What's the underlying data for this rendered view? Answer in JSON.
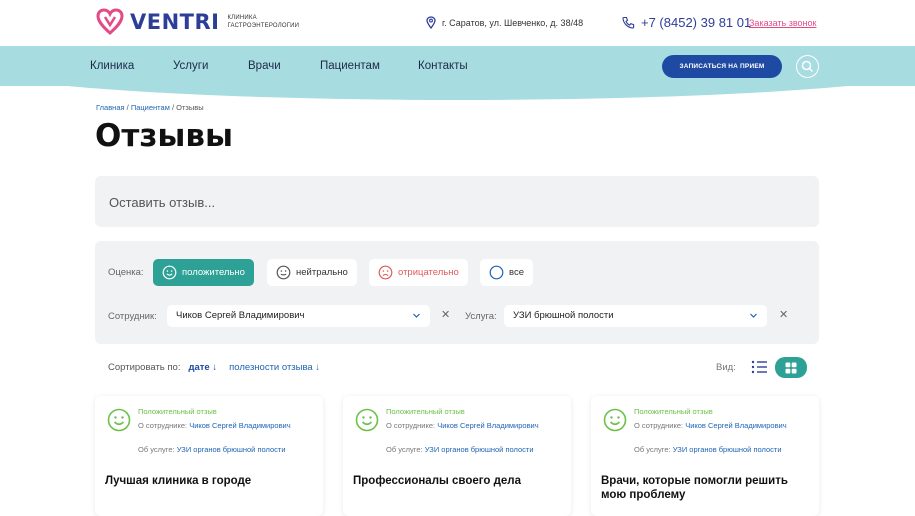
{
  "header": {
    "logo_text": "VENTRI",
    "logo_subtitle": "Клиника гастроэнтерологии",
    "address": "г. Саратов, ул. Шевченко, д. 38/48",
    "phone": "+7 (8452) 39 81 01",
    "callback": "Заказать звонок"
  },
  "nav": {
    "items": [
      "Клиника",
      "Услуги",
      "Врачи",
      "Пациентам",
      "Контакты"
    ],
    "appointment_button": "ЗАПИСАТЬСЯ НА ПРИЕМ"
  },
  "breadcrumb": {
    "home": "Главная",
    "patients": "Пациентам",
    "current": "Отзывы",
    "sep": " / "
  },
  "page_title": "Отзывы",
  "leave_review_placeholder": "Оставить отзыв...",
  "filters": {
    "rating_label": "Оценка:",
    "rating_options": [
      "положительно",
      "нейтрально",
      "отрицательно",
      "все"
    ],
    "employee_label": "Сотрудник:",
    "employee_value": "Чиков Сергей Владимирович",
    "service_label": "Услуга:",
    "service_value": "УЗИ брюшной полости",
    "clear_glyph": "✕"
  },
  "sort": {
    "label": "Сортировать по:",
    "by_date": "дате ↓",
    "by_usefulness": "полезности отзыва ↓",
    "view_label": "Вид:"
  },
  "reviews": [
    {
      "sentiment": "Положительный отзыв",
      "employee_prefix": "О сотруднике:",
      "employee": "Чиков Сергей Владимирович",
      "service_prefix": "Об услуге:",
      "service": "УЗИ органов брюшной полости",
      "title": "Лучшая клиника в городе"
    },
    {
      "sentiment": "Положительный отзыв",
      "employee_prefix": "О сотруднике:",
      "employee": "Чиков Сергей Владимирович",
      "service_prefix": "Об услуге:",
      "service": "УЗИ органов брюшной полости",
      "title": "Профессионалы своего дела"
    },
    {
      "sentiment": "Положительный отзыв",
      "employee_prefix": "О сотруднике:",
      "employee": "Чиков Сергей Владимирович",
      "service_prefix": "Об услуге:",
      "service": "УЗИ органов брюшной полости",
      "title": "Врачи, которые помогли решить мою проблему"
    }
  ],
  "colors": {
    "brand_blue": "#2d3e98",
    "teal": "#2ea197",
    "nav_bg": "#a7dce0",
    "accent_pink": "#e34a86",
    "positive_green": "#6cc04a",
    "negative_red": "#e05b5b"
  },
  "icons": [
    "ventri-logo-icon",
    "location-pin-icon",
    "phone-icon",
    "search-icon",
    "smile-icon",
    "neutral-face-icon",
    "sad-face-icon",
    "circle-icon",
    "chevron-down-icon",
    "close-icon",
    "list-view-icon",
    "grid-view-icon"
  ]
}
